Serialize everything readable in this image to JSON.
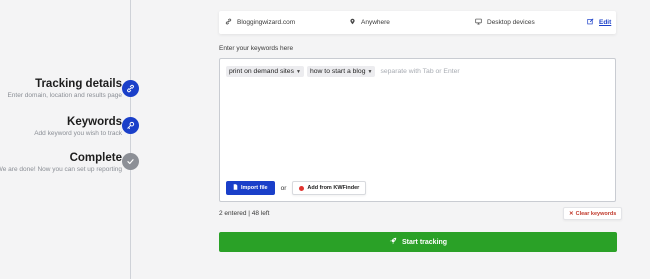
{
  "stepper": {
    "steps": [
      {
        "title": "Tracking details",
        "desc": "Enter domain, location and results page",
        "state": "active",
        "icon": "link-icon"
      },
      {
        "title": "Keywords",
        "desc": "Add keyword you wish to track",
        "state": "active",
        "icon": "key-icon"
      },
      {
        "title": "Complete",
        "desc": "We are done! Now you can set up reporting",
        "state": "done",
        "icon": "check-icon"
      }
    ]
  },
  "settings": {
    "domain": "Bloggingwizard.com",
    "location": "Anywhere",
    "device": "Desktop devices",
    "edit_label": "Edit"
  },
  "keywords": {
    "label": "Enter your keywords here",
    "tags": [
      "print on demand sites",
      "how to start a blog"
    ],
    "placeholder": "separate with Tab or Enter",
    "import_label": "Import file",
    "or_label": "or",
    "kwfinder_label": "Add from KWFinder",
    "count_text": "2 entered | 48 left",
    "clear_label": "Clear keywords"
  },
  "actions": {
    "start_label": "Start tracking"
  },
  "colors": {
    "accent": "#1a3fc9",
    "success": "#2aa127",
    "danger": "#c0392b"
  }
}
